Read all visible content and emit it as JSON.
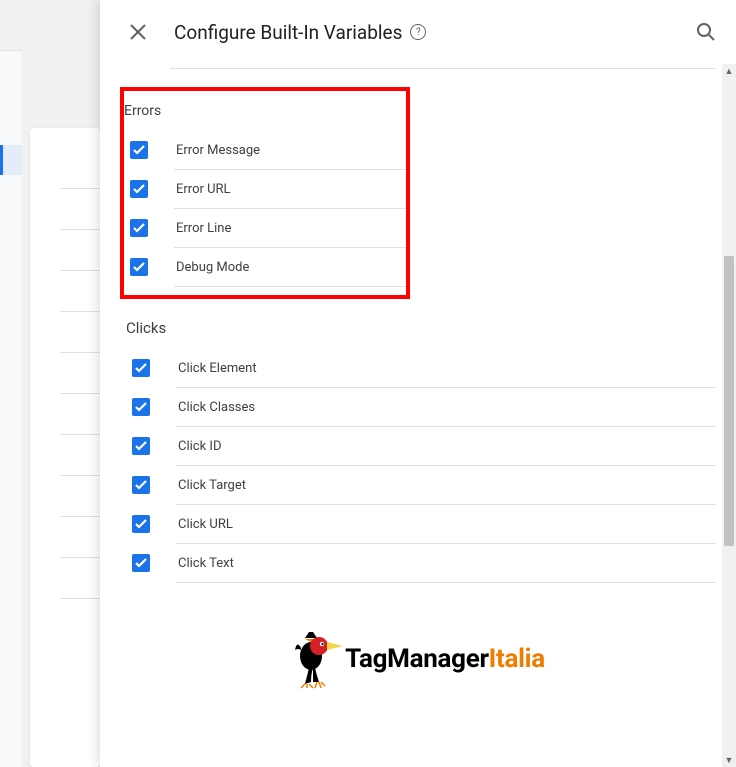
{
  "header": {
    "title": "Configure Built-In Variables"
  },
  "sections": {
    "errors": {
      "title": "Errors",
      "items": [
        "Error Message",
        "Error URL",
        "Error Line",
        "Debug Mode"
      ]
    },
    "clicks": {
      "title": "Clicks",
      "items": [
        "Click Element",
        "Click Classes",
        "Click ID",
        "Click Target",
        "Click URL",
        "Click Text"
      ]
    }
  },
  "logo": {
    "brand": "TagManager",
    "suffix": "Italia"
  }
}
